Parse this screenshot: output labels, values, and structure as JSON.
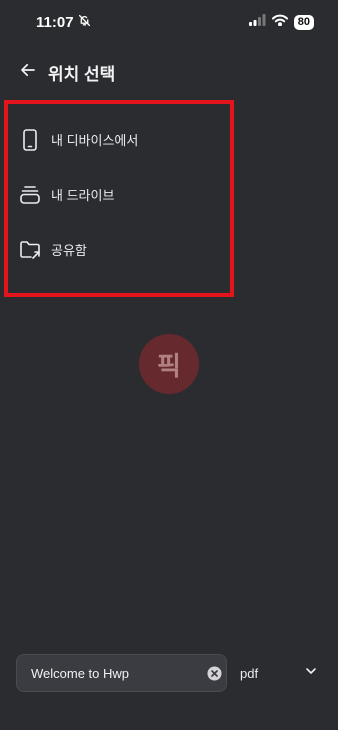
{
  "status_bar": {
    "time": "11:07",
    "battery": "80"
  },
  "header": {
    "title": "위치 선택"
  },
  "locations": [
    {
      "label": "내 디바이스에서",
      "icon": "phone-icon"
    },
    {
      "label": "내 드라이브",
      "icon": "drive-icon"
    },
    {
      "label": "공유함",
      "icon": "shared-folder-icon"
    }
  ],
  "watermark": {
    "text": "픽"
  },
  "save_bar": {
    "filename_value": "Welcome to Hwp",
    "format_value": "pdf"
  },
  "colors": {
    "background": "#2b2c30",
    "highlight_border": "#e3141b",
    "field_bg": "#3b3c41"
  }
}
